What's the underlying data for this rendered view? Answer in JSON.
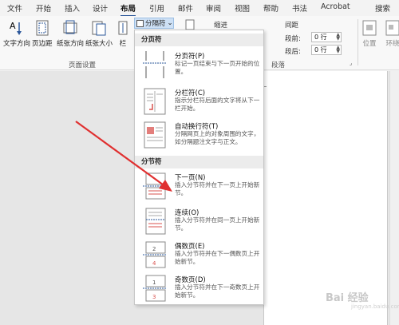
{
  "tabs": [
    "文件",
    "开始",
    "插入",
    "设计",
    "布局",
    "引用",
    "邮件",
    "审阅",
    "视图",
    "帮助",
    "书法",
    "Acrobat",
    "搜索"
  ],
  "active_tab": "布局",
  "ribbon": {
    "buttons": [
      "文字方向",
      "页边距",
      "纸张方向",
      "纸张大小",
      "栏"
    ],
    "group_page_setup": "页面设置",
    "breaks_button": "分隔符",
    "indent_label": "缩进",
    "spacing_label": "间距",
    "spacing_before_label": "段前:",
    "spacing_after_label": "段后:",
    "spacing_before_value": "0 行",
    "spacing_after_value": "0 行",
    "group_paragraph": "段落",
    "position_label": "位置",
    "wrap_label": "环绕"
  },
  "menu": {
    "section1_title": "分页符",
    "section2_title": "分节符",
    "items": [
      {
        "title": "分页符(P)",
        "desc": "标记一页结束与下一页开始的位置。"
      },
      {
        "title": "分栏符(C)",
        "desc": "指示分栏符后面的文字将从下一栏开始。"
      },
      {
        "title": "自动换行符(T)",
        "desc": "分隔网页上的对象周围的文字，如分隔题注文字与正文。"
      },
      {
        "title": "下一页(N)",
        "desc": "插入分节符并在下一页上开始新节。"
      },
      {
        "title": "连续(O)",
        "desc": "插入分节符并在同一页上开始新节。"
      },
      {
        "title": "偶数页(E)",
        "desc": "插入分节符并在下一偶数页上开始新节。"
      },
      {
        "title": "奇数页(D)",
        "desc": "插入分节符并在下一奇数页上开始新节。"
      }
    ]
  },
  "watermark": {
    "text": "Bai 经验",
    "sub": "jingyan.baidu.com"
  },
  "colors": {
    "accent": "#2b579a",
    "arrow": "#e03030",
    "thumb_red": "#d9534f"
  }
}
